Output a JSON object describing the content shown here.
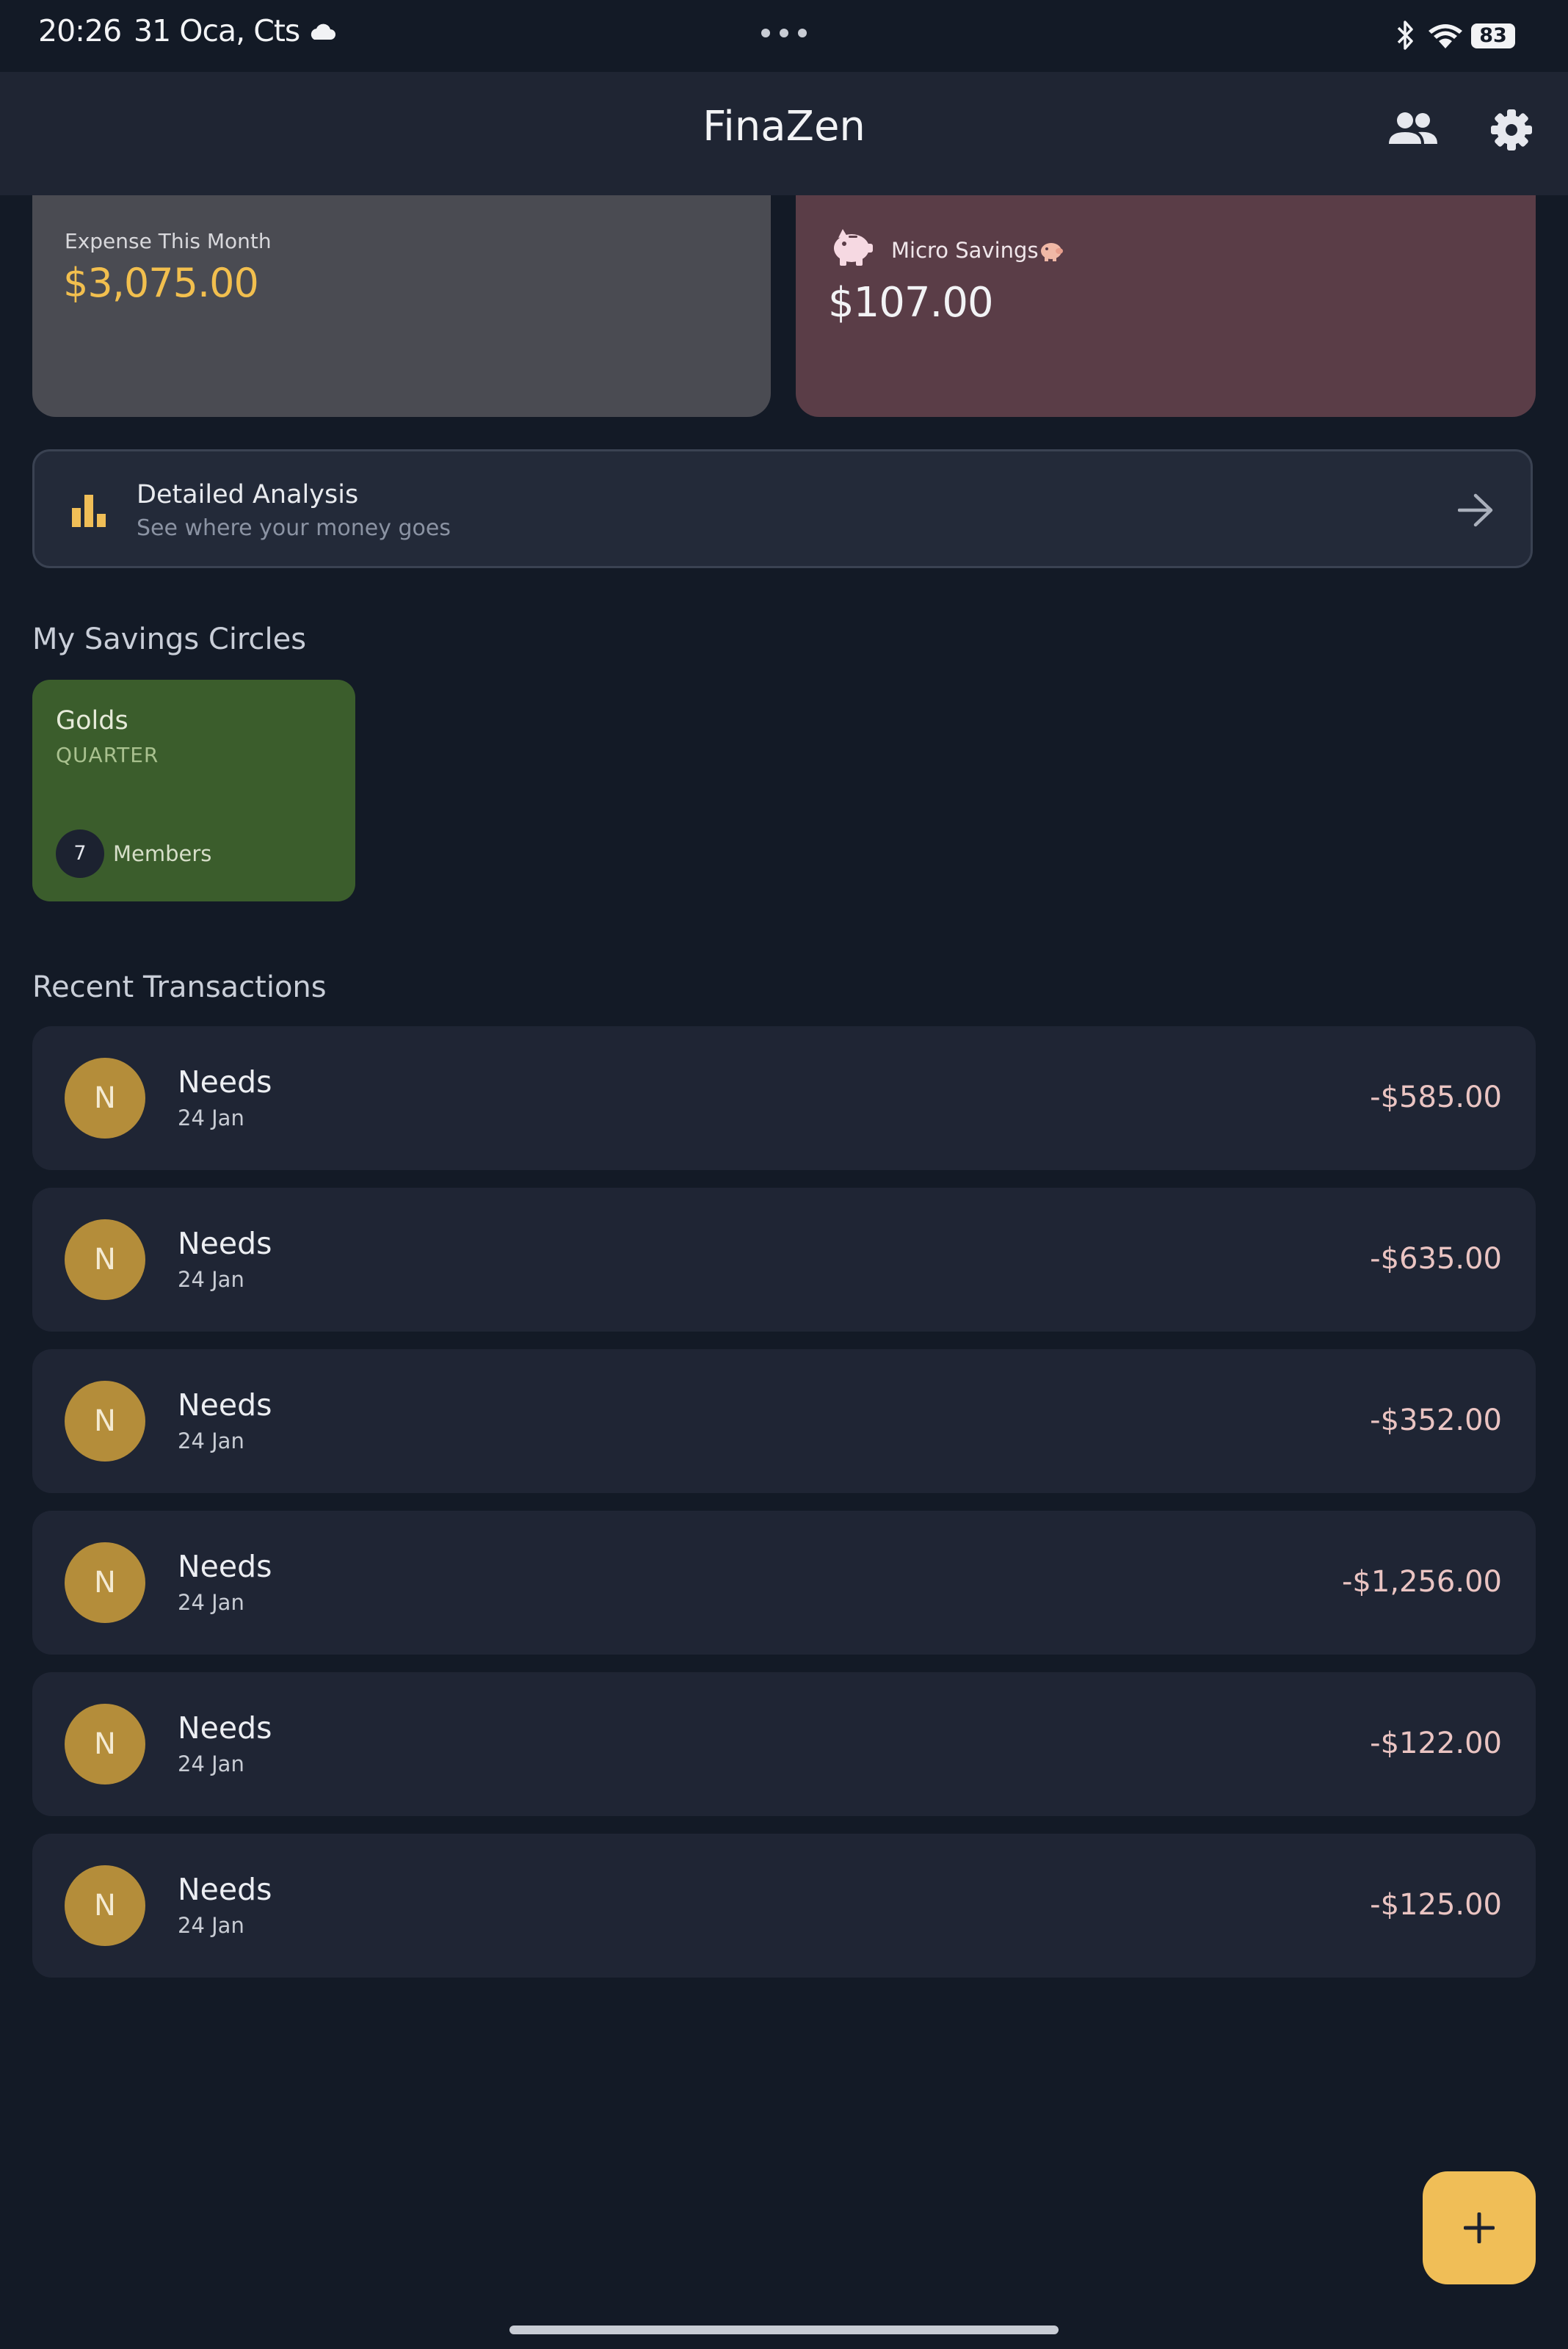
{
  "status_bar": {
    "time": "20:26",
    "date": "31 Oca, Cts",
    "battery": "83"
  },
  "header": {
    "title": "FinaZen"
  },
  "summary": {
    "expense_label": "Expense This Month",
    "expense_amount": "$3,075.00",
    "micro_label": "Micro Savings",
    "micro_amount": "$107.00"
  },
  "analysis": {
    "title": "Detailed Analysis",
    "subtitle": "See where your money goes"
  },
  "circles": {
    "section_title": "My Savings Circles",
    "items": [
      {
        "name": "Golds",
        "period": "QUARTER",
        "member_count": "7",
        "members_label": "Members"
      }
    ]
  },
  "transactions": {
    "section_title": "Recent Transactions",
    "items": [
      {
        "initial": "N",
        "name": "Needs",
        "date": "24 Jan",
        "amount": "-$585.00"
      },
      {
        "initial": "N",
        "name": "Needs",
        "date": "24 Jan",
        "amount": "-$635.00"
      },
      {
        "initial": "N",
        "name": "Needs",
        "date": "24 Jan",
        "amount": "-$352.00"
      },
      {
        "initial": "N",
        "name": "Needs",
        "date": "24 Jan",
        "amount": "-$1,256.00"
      },
      {
        "initial": "N",
        "name": "Needs",
        "date": "24 Jan",
        "amount": "-$122.00"
      },
      {
        "initial": "N",
        "name": "Needs",
        "date": "24 Jan",
        "amount": "-$125.00"
      }
    ]
  },
  "colors": {
    "background": "#131a26",
    "accent": "#f0be57",
    "expense_card": "#4a4b52",
    "micro_card": "#5a3d47",
    "circle_card": "#3b5d2c",
    "avatar": "#b48d3a"
  },
  "icons": [
    "cloud-icon",
    "bluetooth-icon",
    "wifi-icon",
    "group-icon",
    "gear-icon",
    "piggy-bank-icon",
    "bar-chart-icon",
    "arrow-right-icon",
    "plus-icon"
  ]
}
